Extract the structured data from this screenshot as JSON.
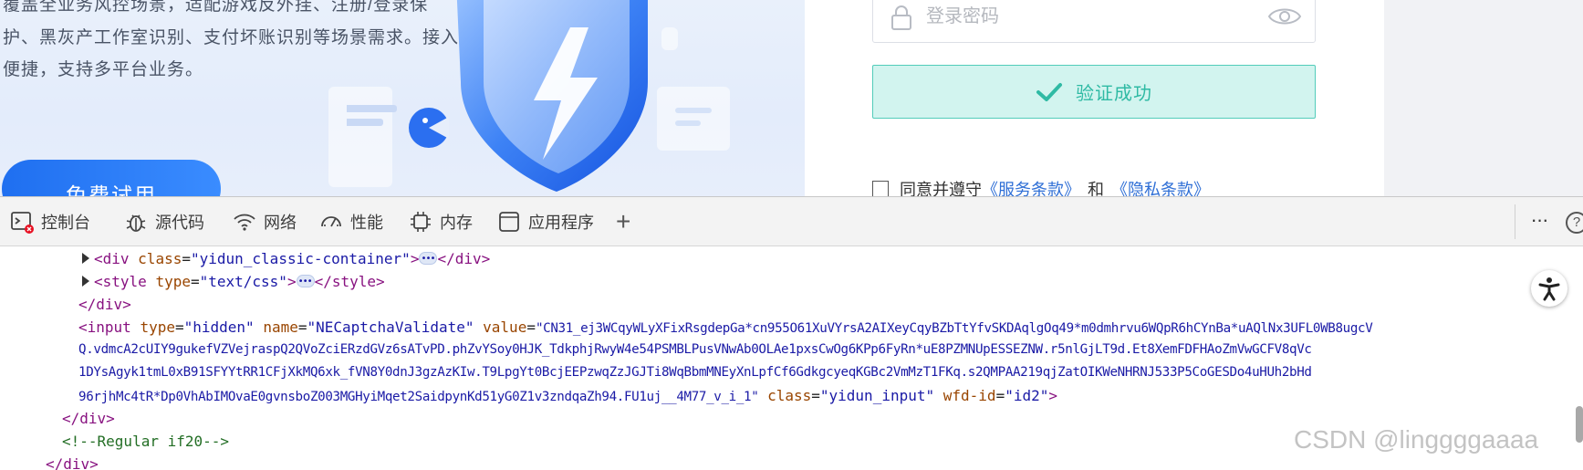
{
  "hero": {
    "line_1": "覆盖全业务风控场景，适配游戏反外挂、注册/登录保",
    "line_2": "护、黑灰产工作室识别、支付坏账识别等场景需求。接入",
    "line_3": "便捷，支持多平台业务。",
    "trial_button": "免费试用"
  },
  "login": {
    "password_placeholder": "登录密码",
    "verify_text": "验证成功",
    "agree_text": "同意并遵守",
    "terms_link": "《服务条款》",
    "and_text": "和",
    "privacy_link": "《隐私条款》"
  },
  "devtools": {
    "tabs": {
      "console": "控制台",
      "sources": "源代码",
      "network": "网络",
      "performance": "性能",
      "memory": "内存",
      "application": "应用程序"
    },
    "add_tab": "+",
    "more": "···",
    "help": "?",
    "code": {
      "l1_tag": "<div ",
      "l1_attr": "class",
      "l1_val": "\"yidun_classic-container\"",
      "l1_close_open": ">",
      "l1_end": "</div>",
      "l2_tag": "<style ",
      "l2_attr": "type",
      "l2_val": "\"text/css\"",
      "l2_close_open": ">",
      "l2_end": "</style>",
      "l3": "</div>",
      "l4_tag": "<input ",
      "l4_attr1": "type",
      "l4_val1": "\"hidden\"",
      "l4_attr2": "name",
      "l4_val2": "\"NECaptchaValidate\"",
      "l4_attr3": "value",
      "l4_val3_part1": "\"CN31_ej3WCqyWLyXFixRsgdepGa*cn955O61XuVYrsA2AIXeyCqyBZbTtYfvSKDAqlgOq49*m0dmhrvu6WQpR6hCYnBa*uAQlNx3UFL0WB8ugcV",
      "l4_val3_part2": "Q.vdmcA2cUIY9gukefVZVejraspQ2QVoZciERzdGVz6sATvPD.phZvYSoy0HJK_TdkphjRwyW4e54PSMBLPusVNwAb0OLAe1pxsCwOg6KPp6FyRn*uE8PZMNUpESSEZNW.r5nlGjLT9d.Et8XemFDFHAoZmVwGCFV8qVc",
      "l4_val3_part3": "1DYsAgyk1tmL0xB91SFYYtRR1CFjXkMQ6xk_fVN8Y0dnJ3gzAzKIw.T9LpgYt0BcjEEPzwqZzJGJTi8WqBbmMNEyXnLpfCf6GdkgcyeqKGBc2VmMzT1FKq.s2QMPAA219qjZatOIKWeNHRNJ533P5CoGESDo4uHUh2bHd",
      "l4_val3_part4": "96rjhMc4tR*Dp0VhAbIMOvaE0gvnsboZ003MGHyiMqet2SaidpynKd51yG0Z1v3zndqaZh94.FU1uj__4M77_v_i_1\"",
      "l4_attr4": "class",
      "l4_val4": "\"yidun_input\"",
      "l4_attr5": "wfd-id",
      "l4_val5": "\"id2\"",
      "l4_end": ">",
      "l5": "</div>",
      "l6": "<!--Regular if20-->",
      "l7": "</div>"
    }
  },
  "watermark": "CSDN @linggggaaaa",
  "colors": {
    "verify_bg": "#d2f4ef",
    "verify_border": "#52ccba",
    "verify_text": "#2fbaa4",
    "link": "#2f6fd6",
    "tag": "#881280",
    "attr": "#994500",
    "value": "#1a1aa6",
    "comment": "#236e25",
    "error_badge": "#e81123"
  }
}
